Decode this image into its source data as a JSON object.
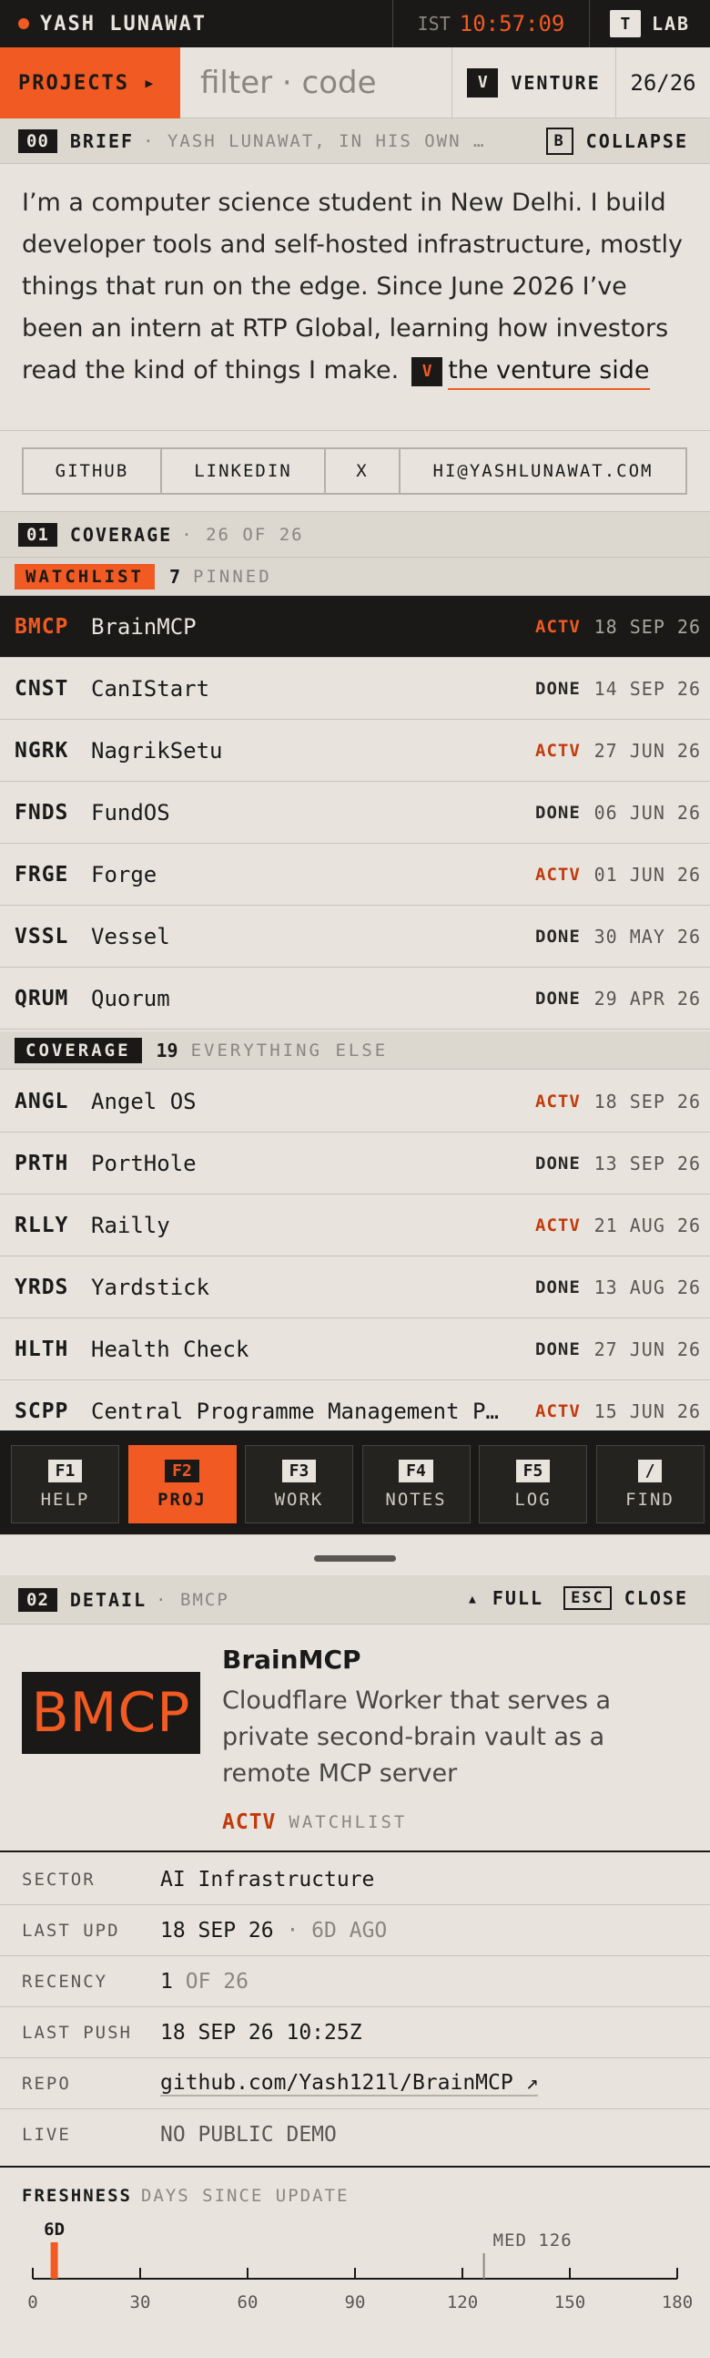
{
  "topbar": {
    "brand": "YASH LUNAWAT",
    "tz": "IST",
    "time": "10:57:09",
    "lab_key": "T",
    "lab_label": "LAB"
  },
  "row2": {
    "projects_label": "PROJECTS ▸",
    "filter_placeholder": "filter · code",
    "venture_key": "V",
    "venture_label": "VENTURE",
    "count": "26/26"
  },
  "brief": {
    "num": "00",
    "title": "BRIEF",
    "subtitle": "· YASH LUNAWAT, IN HIS OWN WORDS",
    "collapse_key": "B",
    "collapse_label": "COLLAPSE",
    "body": "I’m a computer science student in New Delhi. I build developer tools and self-hosted infrastructure, mostly things that run on the edge. Since June 2026 I’ve been an intern at RTP Global, learning how investors read the kind of things I make.",
    "venture_key": "V",
    "venture_link": "the venture side"
  },
  "social": [
    "GITHUB",
    "LINKEDIN",
    "X",
    "HI@YASHLUNAWAT.COM"
  ],
  "coverage": {
    "num": "01",
    "title": "COVERAGE",
    "subtitle": "· 26 OF 26"
  },
  "watchlist": {
    "tag": "WATCHLIST",
    "count": "7",
    "label": "PINNED",
    "rows": [
      {
        "code": "BMCP",
        "name": "BrainMCP",
        "status": "ACTV",
        "date": "18 SEP 26"
      },
      {
        "code": "CNST",
        "name": "CanIStart",
        "status": "DONE",
        "date": "14 SEP 26"
      },
      {
        "code": "NGRK",
        "name": "NagrikSetu",
        "status": "ACTV",
        "date": "27 JUN 26"
      },
      {
        "code": "FNDS",
        "name": "FundOS",
        "status": "DONE",
        "date": "06 JUN 26"
      },
      {
        "code": "FRGE",
        "name": "Forge",
        "status": "ACTV",
        "date": "01 JUN 26"
      },
      {
        "code": "VSSL",
        "name": "Vessel",
        "status": "DONE",
        "date": "30 MAY 26"
      },
      {
        "code": "QRUM",
        "name": "Quorum",
        "status": "DONE",
        "date": "29 APR 26"
      }
    ]
  },
  "others": {
    "tag": "COVERAGE",
    "count": "19",
    "label": "EVERYTHING ELSE",
    "rows": [
      {
        "code": "ANGL",
        "name": "Angel OS",
        "status": "ACTV",
        "date": "18 SEP 26"
      },
      {
        "code": "PRTH",
        "name": "PortHole",
        "status": "DONE",
        "date": "13 SEP 26"
      },
      {
        "code": "RLLY",
        "name": "Railly",
        "status": "ACTV",
        "date": "21 AUG 26"
      },
      {
        "code": "YRDS",
        "name": "Yardstick",
        "status": "DONE",
        "date": "13 AUG 26"
      },
      {
        "code": "HLTH",
        "name": "Health Check",
        "status": "DONE",
        "date": "27 JUN 26"
      },
      {
        "code": "SCPP",
        "name": "Central Programme Management Portal",
        "status": "ACTV",
        "date": "15 JUN 26"
      }
    ]
  },
  "dock": [
    {
      "key": "F1",
      "label": "HELP"
    },
    {
      "key": "F2",
      "label": "PROJ"
    },
    {
      "key": "F3",
      "label": "WORK"
    },
    {
      "key": "F4",
      "label": "NOTES"
    },
    {
      "key": "F5",
      "label": "LOG"
    },
    {
      "key": "/",
      "label": "FIND"
    }
  ],
  "detail": {
    "num": "02",
    "title": "DETAIL",
    "subtitle": "· BMCP",
    "full_label": "▴ FULL",
    "esc_key": "ESC",
    "close_label": "CLOSE",
    "logo": "BMCP",
    "name": "BrainMCP",
    "description": "Cloudflare Worker that serves a private second-brain vault as a remote MCP server",
    "status": "ACTV",
    "group": "WATCHLIST",
    "fields": {
      "sector_k": "SECTOR",
      "sector_v": "AI Infrastructure",
      "lastupd_k": "LAST UPD",
      "lastupd_v": "18 SEP 26",
      "lastupd_ago": "· 6D AGO",
      "recency_k": "RECENCY",
      "recency_v": "1",
      "recency_of": "OF 26",
      "lastpush_k": "LAST PUSH",
      "lastpush_v": "18 SEP 26 10:25Z",
      "repo_k": "REPO",
      "repo_v": "github.com/Yash121l/BrainMCP ↗",
      "live_k": "LIVE",
      "live_v": "NO PUBLIC DEMO"
    }
  },
  "chart_data": {
    "type": "bar",
    "title": "FRESHNESS",
    "subtitle": "DAYS SINCE UPDATE",
    "xlim": [
      0,
      180
    ],
    "ticks": [
      0,
      30,
      60,
      90,
      120,
      150,
      180
    ],
    "value": 6,
    "value_label": "6D",
    "median": 126,
    "median_label": "MED 126",
    "accent": "#f15a22"
  }
}
